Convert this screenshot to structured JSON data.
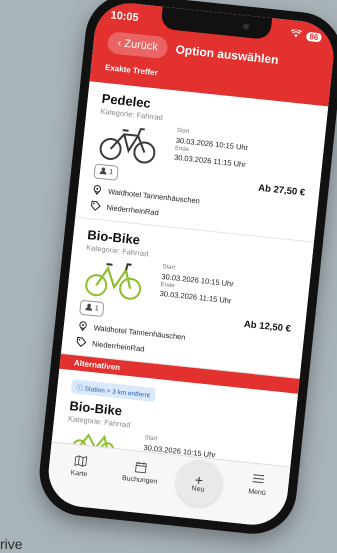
{
  "status": {
    "time": "10:05",
    "battery": "86"
  },
  "header": {
    "back_label": "Zurück",
    "title": "Option auswählen",
    "section": "Exakte Treffer"
  },
  "results": [
    {
      "name": "Pedelec",
      "category": "Kategorie: Fahrrad",
      "start_label": "Start",
      "start": "30.03.2026 10:15 Uhr",
      "end_label": "Ende",
      "end": "30.03.2026 11:15 Uhr",
      "seats": "1",
      "price": "Ab 27,50 €",
      "location": "Waldhotel Tannenhäuschen",
      "provider": "NiederrheinRad",
      "bike_color": "#3a3a3a"
    },
    {
      "name": "Bio-Bike",
      "category": "Kategorie: Fahrrad",
      "start_label": "Start",
      "start": "30.03.2026 10:15 Uhr",
      "end_label": "Ende",
      "end": "30.03.2026 11:15 Uhr",
      "seats": "1",
      "price": "Ab 12,50 €",
      "location": "Waldhotel Tannenhäuschen",
      "provider": "NiederrheinRad",
      "bike_color": "#8bbf2e"
    }
  ],
  "alternatives": {
    "section": "Alternativen",
    "badge": "Station > 3 km entfernt",
    "item": {
      "name": "Bio-Bike",
      "category": "Kategorie: Fahrrad",
      "start_label": "Start",
      "start": "30.03.2026 10:15 Uhr"
    }
  },
  "bottom_nav": {
    "map": "Karte",
    "bookings": "Buchungen",
    "new": "Neu",
    "menu": "Menü"
  },
  "caption": "rive",
  "colors": {
    "accent": "#e2312f",
    "badge_bg": "#d9e8fb"
  }
}
